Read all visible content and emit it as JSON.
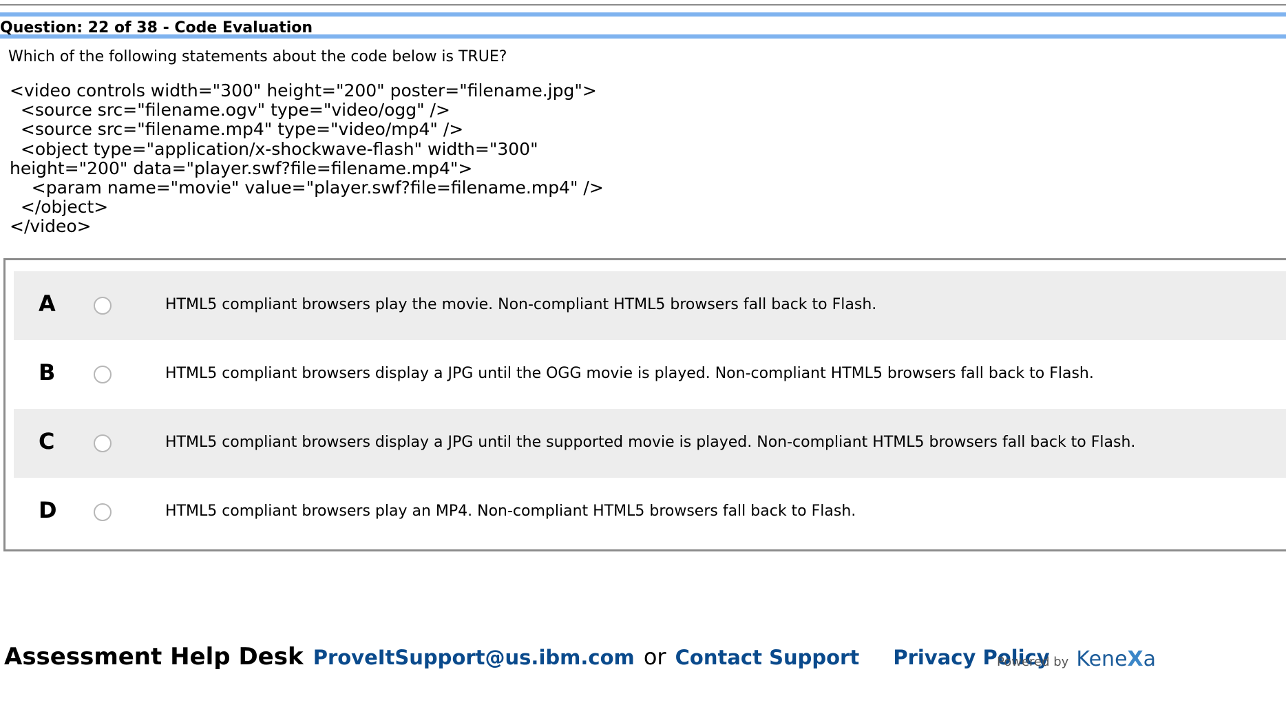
{
  "header": {
    "question_label": "Question: 22 of 38",
    "separator": " - ",
    "section_title": "Code Evaluation"
  },
  "question": {
    "prompt": "Which of the following statements about the code below is TRUE?",
    "code": "<video controls width=\"300\" height=\"200\" poster=\"filename.jpg\">\n  <source src=\"filename.ogv\" type=\"video/ogg\" />\n  <source src=\"filename.mp4\" type=\"video/mp4\" />\n  <object type=\"application/x-shockwave-flash\" width=\"300\"\nheight=\"200\" data=\"player.swf?file=filename.mp4\">\n    <param name=\"movie\" value=\"player.swf?file=filename.mp4\" />\n  </object>\n</video>"
  },
  "answers": [
    {
      "letter": "A",
      "text": "HTML5 compliant browsers play the movie. Non-compliant HTML5 browsers fall back to Flash.",
      "selected": false
    },
    {
      "letter": "B",
      "text": "HTML5 compliant browsers display a JPG until the OGG movie is played. Non-compliant HTML5 browsers fall back to Flash.",
      "selected": false
    },
    {
      "letter": "C",
      "text": "HTML5 compliant browsers display a JPG until the supported movie is played. Non-compliant HTML5 browsers fall back to Flash.",
      "selected": false
    },
    {
      "letter": "D",
      "text": "HTML5 compliant browsers play an MP4. Non-compliant HTML5 browsers fall back to Flash.",
      "selected": false
    }
  ],
  "footer": {
    "help_label": "Assessment Help Desk",
    "email_link": "ProveItSupport@us.ibm.com",
    "or_text": "or",
    "contact_link": "Contact Support",
    "privacy_link": "Privacy Policy",
    "powered_by": "Powered by",
    "brand_prefix": "Kene",
    "brand_x": "X",
    "brand_suffix": "a"
  },
  "colors": {
    "header_rule": "#7fb3ef",
    "row_shade": "#ededed",
    "link": "#0a4a8c",
    "brand": "#1c5c9a"
  }
}
